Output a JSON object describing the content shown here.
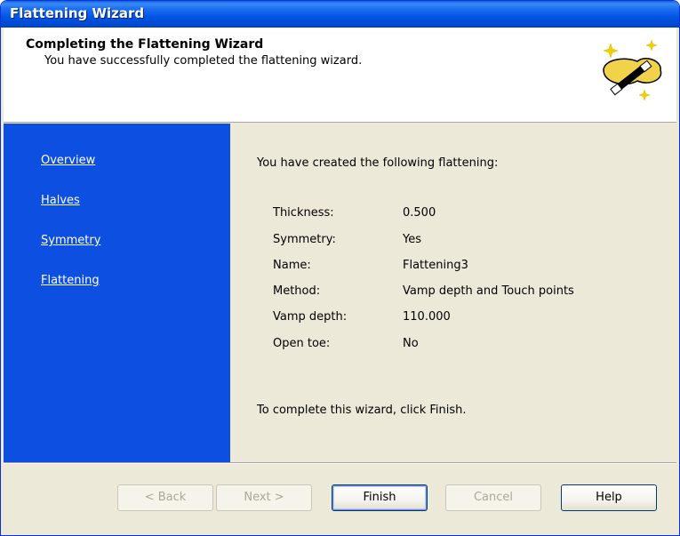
{
  "window": {
    "title": "Flattening Wizard"
  },
  "header": {
    "title": "Completing the Flattening Wizard",
    "subtitle": "You have successfully completed the flattening wizard.",
    "icon": "magic-wand-icon"
  },
  "sidebar": {
    "items": [
      {
        "label": "Overview"
      },
      {
        "label": "Halves"
      },
      {
        "label": "Symmetry"
      },
      {
        "label": "Flattening"
      }
    ]
  },
  "content": {
    "intro": "You have created the following flattening:",
    "rows": [
      {
        "label": "Thickness:",
        "value": "0.500"
      },
      {
        "label": "Symmetry:",
        "value": "Yes"
      },
      {
        "label": "Name:",
        "value": "Flattening3"
      },
      {
        "label": "Method:",
        "value": "Vamp depth and Touch points"
      },
      {
        "label": "Vamp depth:",
        "value": "110.000"
      },
      {
        "label": "Open toe:",
        "value": "No"
      }
    ],
    "outro": "To complete this wizard, click Finish."
  },
  "buttons": {
    "back": "< Back",
    "next": "Next >",
    "finish": "Finish",
    "cancel": "Cancel",
    "help": "Help"
  },
  "colors": {
    "sidebar": "#0d4fe0",
    "titlebar": "#0055e5",
    "dialog": "#ece9d8"
  }
}
